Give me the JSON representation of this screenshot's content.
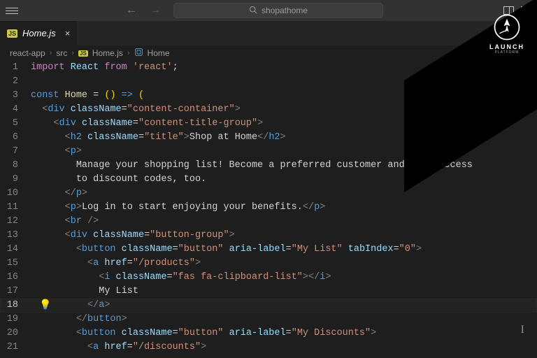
{
  "titlebar": {
    "search_text": "shopathome"
  },
  "tab": {
    "badge": "JS",
    "filename": "Home.js"
  },
  "breadcrumbs": {
    "seg1": "react-app",
    "seg2": "src",
    "file_badge": "JS",
    "file": "Home.js",
    "symbol": "Home"
  },
  "corner": {
    "label": "LAUNCH",
    "sub": "PLATFORM"
  },
  "code": {
    "l1_import": "import",
    "l1_react": "React",
    "l1_from": "from",
    "l1_mod": "'react'",
    "l3_const": "const",
    "l3_home": "Home",
    "l4_div_open_a": "<",
    "div_tag": "div",
    "class_attr": "className",
    "l4_cls": "\"content-container\"",
    "l5_cls": "\"content-title-group\"",
    "h2_tag": "h2",
    "l6_cls": "\"title\"",
    "l6_text": "Shop at Home",
    "p_tag": "p",
    "l8_text": "Manage your shopping list! Become a preferred customer and gain access",
    "l9_text": "to discount codes, too.",
    "l11_text": "Log in to start enjoying your benefits.",
    "br_tag": "br",
    "l13_cls": "\"button-group\"",
    "btn_tag": "button",
    "l14_cls": "\"button\"",
    "aria_attr": "aria-label",
    "l14_aria": "\"My List\"",
    "tab_attr": "tabIndex",
    "l14_tab": "\"0\"",
    "a_tag": "a",
    "href_attr": "href",
    "l15_href": "\"/products\"",
    "i_tag": "i",
    "l16_cls": "\"fas fa-clipboard-list\"",
    "l17_text": "My List",
    "l20_aria": "\"My Discounts\"",
    "l21_href": "\"/discounts\""
  },
  "lines": [
    "1",
    "2",
    "3",
    "4",
    "5",
    "6",
    "7",
    "8",
    "9",
    "10",
    "11",
    "12",
    "13",
    "14",
    "15",
    "16",
    "17",
    "18",
    "19",
    "20",
    "21"
  ]
}
